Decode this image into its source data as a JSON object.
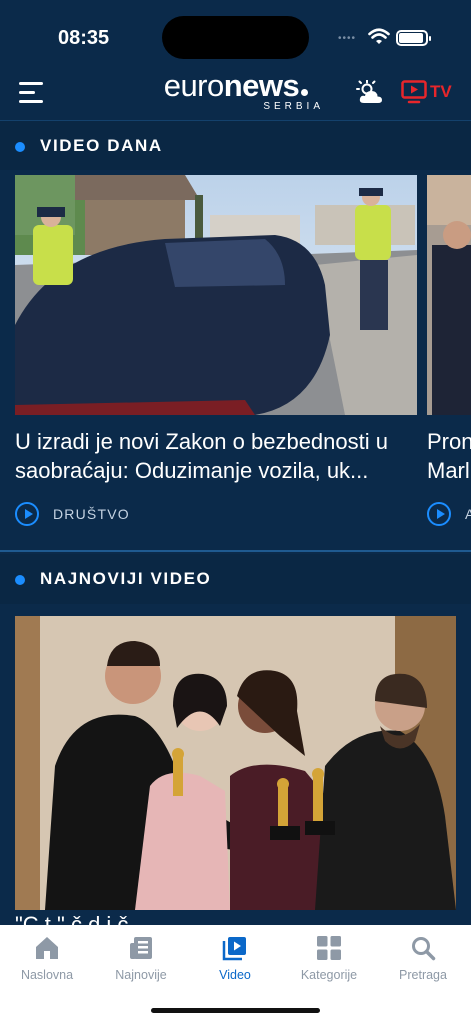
{
  "status": {
    "time": "08:35"
  },
  "header": {
    "logo_main_light": "euro",
    "logo_main_bold": "news",
    "logo_sub": "SERBIA",
    "tv_label": "TV"
  },
  "sections": {
    "video_dana": "VIDEO DANA",
    "najnoviji_video": "NAJNOVIJI VIDEO"
  },
  "video_dana_cards": [
    {
      "title": "U izradi je novi Zakon o bezbednosti u saobraćaju: Oduzimanje vozila, uk...",
      "category": "DRUŠTVO"
    },
    {
      "title": "Pron Marl",
      "category": "A"
    }
  ],
  "latest": {
    "title_partial": "\"C      t       \" č          d   j           č"
  },
  "tabbar": {
    "items": [
      {
        "label": "Naslovna",
        "icon": "home-icon"
      },
      {
        "label": "Najnovije",
        "icon": "news-icon"
      },
      {
        "label": "Video",
        "icon": "video-icon"
      },
      {
        "label": "Kategorije",
        "icon": "grid-icon"
      },
      {
        "label": "Pretraga",
        "icon": "search-icon"
      }
    ],
    "active": "Video"
  },
  "colors": {
    "background": "#0b2a4a",
    "accent": "#1b8dff",
    "tv_red": "#e8262b",
    "tab_active": "#0b68c9"
  }
}
